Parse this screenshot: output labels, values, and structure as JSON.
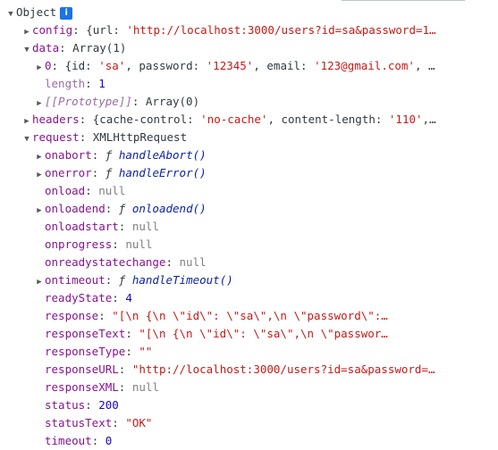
{
  "root": {
    "label": "Object"
  },
  "config": {
    "key": "config",
    "value": "{url: ",
    "url": "'http://localhost:3000/users?id=sa&password=1…"
  },
  "data": {
    "key": "data",
    "value": "Array(1)",
    "item0": {
      "key": "0",
      "open": "{id: ",
      "id": "'sa'",
      "pw_label": ", password: ",
      "pw": "'12345'",
      "email_label": ", email: ",
      "email": "'123@gmail.com'",
      "tail": ", …"
    },
    "length": {
      "key": "length",
      "value": "1"
    },
    "proto": {
      "key": "[[Prototype]]",
      "value": "Array(0)"
    }
  },
  "headers": {
    "key": "headers",
    "open": "{cache-control: ",
    "cc": "'no-cache'",
    "cl_label": ", content-length: ",
    "cl": "'110'",
    "tail": ",…"
  },
  "request": {
    "key": "request",
    "value": "XMLHttpRequest",
    "onabort": {
      "key": "onabort",
      "fn": "handleAbort()"
    },
    "onerror": {
      "key": "onerror",
      "fn": "handleError()"
    },
    "onload": {
      "key": "onload",
      "value": "null"
    },
    "onloadend": {
      "key": "onloadend",
      "fn": "onloadend()"
    },
    "onloadstart": {
      "key": "onloadstart",
      "value": "null"
    },
    "onprogress": {
      "key": "onprogress",
      "value": "null"
    },
    "onreadystatechange": {
      "key": "onreadystatechange",
      "value": "null"
    },
    "ontimeout": {
      "key": "ontimeout",
      "fn": "handleTimeout()"
    },
    "readyState": {
      "key": "readyState",
      "value": "4"
    },
    "response": {
      "key": "response",
      "value": "\"[\\n  {\\n    \\\"id\\\": \\\"sa\\\",\\n    \\\"password\\\":…"
    },
    "responseText": {
      "key": "responseText",
      "value": "\"[\\n  {\\n    \\\"id\\\": \\\"sa\\\",\\n    \\\"passwor…"
    },
    "responseType": {
      "key": "responseType",
      "value": "\"\""
    },
    "responseURL": {
      "key": "responseURL",
      "value": "\"http://localhost:3000/users?id=sa&password=…"
    },
    "responseXML": {
      "key": "responseXML",
      "value": "null"
    },
    "status": {
      "key": "status",
      "value": "200"
    },
    "statusText": {
      "key": "statusText",
      "value": "\"OK\""
    },
    "timeout": {
      "key": "timeout",
      "value": "0"
    }
  },
  "icons": {
    "expanded": "triangle-down",
    "collapsed": "triangle-right",
    "info": "info-icon"
  },
  "colors": {
    "key": "#881391",
    "string": "#c41a16",
    "number": "#1c00cf",
    "null": "#808080",
    "function": "#0d22aa",
    "info": "#1a73e8"
  }
}
